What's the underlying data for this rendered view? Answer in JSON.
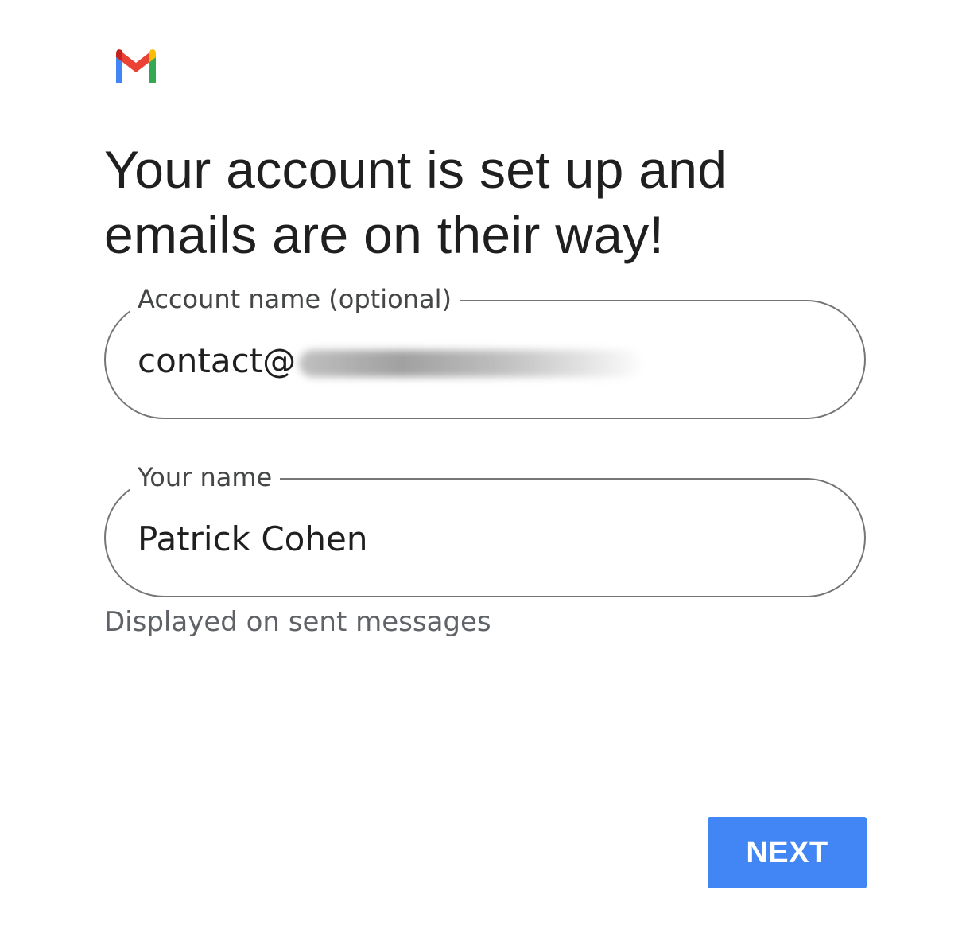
{
  "app": {
    "logo_icon": "gmail-logo-icon",
    "logo_colors": {
      "blue": "#4285f4",
      "red": "#ea4335",
      "yellow": "#fbbc04",
      "green": "#34a853",
      "dark_red": "#c5221f"
    }
  },
  "page": {
    "title": "Your account is set up and emails are on their way!"
  },
  "form": {
    "account_name": {
      "label": "Account name (optional)",
      "value": "contact@",
      "redacted_suffix": true
    },
    "your_name": {
      "label": "Your name",
      "value": "Patrick Cohen",
      "helper_text": "Displayed on sent messages"
    }
  },
  "actions": {
    "next_label": "NEXT",
    "next_color": "#4285f4"
  }
}
